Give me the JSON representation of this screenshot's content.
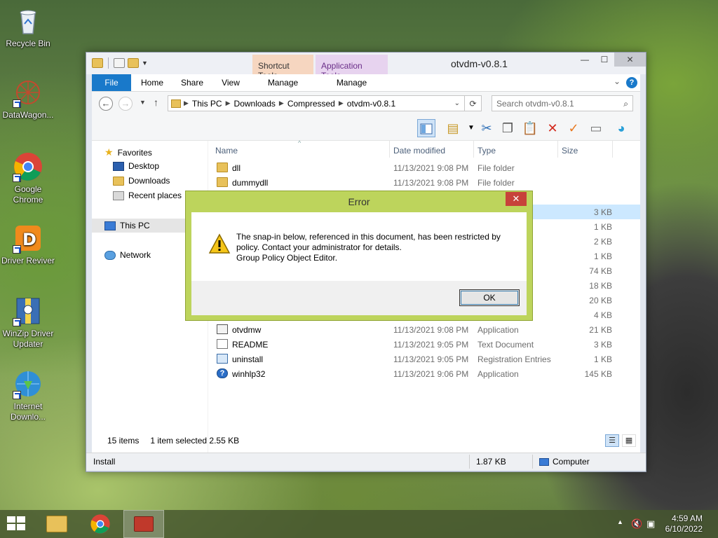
{
  "desktop": {
    "icons": [
      {
        "label": "Recycle Bin"
      },
      {
        "label": "DataWagon..."
      },
      {
        "label": "Google Chrome"
      },
      {
        "label": "Driver Reviver"
      },
      {
        "label": "WinZip Driver Updater"
      },
      {
        "label": "Internet Downlo..."
      }
    ]
  },
  "window": {
    "title": "otvdm-v0.8.1",
    "context_tabs": {
      "shortcut_tools": "Shortcut Tools",
      "application_tools": "Application Tools"
    },
    "ribbon_tabs": [
      "File",
      "Home",
      "Share",
      "View",
      "Manage",
      "Manage"
    ],
    "address": {
      "crumbs": [
        "This PC",
        "Downloads",
        "Compressed",
        "otvdm-v0.8.1"
      ]
    },
    "search_placeholder": "Search otvdm-v0.8.1",
    "nav": {
      "favorites": "Favorites",
      "desktop": "Desktop",
      "downloads": "Downloads",
      "recent": "Recent places",
      "this_pc": "This PC",
      "network": "Network"
    },
    "columns": {
      "name": "Name",
      "date": "Date modified",
      "type": "Type",
      "size": "Size"
    },
    "files_top": [
      {
        "name": "dll",
        "date": "11/13/2021 9:08 PM",
        "type": "File folder",
        "size": "",
        "icon": "folder"
      },
      {
        "name": "dummydll",
        "date": "11/13/2021 9:08 PM",
        "type": "File folder",
        "size": "",
        "icon": "folder"
      }
    ],
    "partial_rows": [
      {
        "type": "",
        "size": "3 KB"
      },
      {
        "type": "ation",
        "size": "1 KB"
      },
      {
        "type": "",
        "size": "2 KB"
      },
      {
        "type": "ation",
        "size": "1 KB"
      },
      {
        "type": "xtens...",
        "size": "74 KB"
      },
      {
        "type": "",
        "size": "18 KB"
      },
      {
        "type": "",
        "size": "20 KB"
      },
      {
        "type": "n sett...",
        "size": "4 KB"
      }
    ],
    "files_bottom": [
      {
        "name": "otvdmw",
        "date": "11/13/2021 9:08 PM",
        "type": "Application",
        "size": "21 KB",
        "icon": "app"
      },
      {
        "name": "README",
        "date": "11/13/2021 9:05 PM",
        "type": "Text Document",
        "size": "3 KB",
        "icon": "txt"
      },
      {
        "name": "uninstall",
        "date": "11/13/2021 9:05 PM",
        "type": "Registration Entries",
        "size": "1 KB",
        "icon": "reg"
      },
      {
        "name": "winhlp32",
        "date": "11/13/2021 9:06 PM",
        "type": "Application",
        "size": "145 KB",
        "icon": "help"
      }
    ],
    "status": {
      "items": "15 items",
      "selected": "1 item selected  2.55 KB"
    },
    "statusbar": {
      "left": "Install",
      "size": "1.87 KB",
      "location": "Computer"
    }
  },
  "dialog": {
    "title": "Error",
    "message_line1": "The snap-in below, referenced in this document, has been restricted by",
    "message_line2": "policy. Contact your administrator for details.",
    "message_line3": "Group Policy Object Editor.",
    "ok": "OK"
  },
  "taskbar": {
    "time": "4:59 AM",
    "date": "6/10/2022"
  }
}
